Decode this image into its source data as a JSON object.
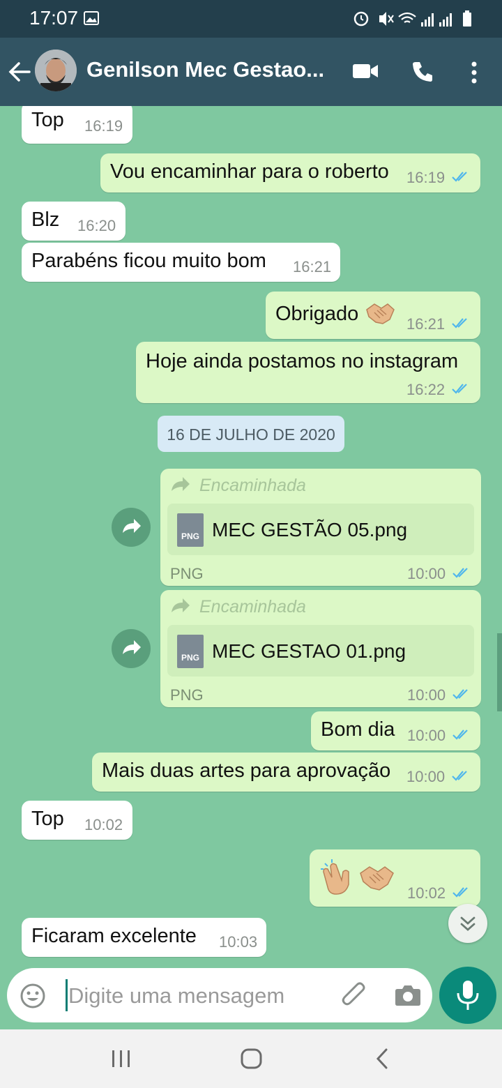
{
  "status_bar": {
    "time": "17:07"
  },
  "header": {
    "contact_name": "Genilson Mec Gestao..."
  },
  "messages": [
    {
      "text": "Top",
      "time": "16:19"
    },
    {
      "text": "Vou encaminhar para o roberto",
      "time": "16:19"
    },
    {
      "text": "Blz",
      "time": "16:20"
    },
    {
      "text": "Parabéns ficou muito bom",
      "time": "16:21"
    },
    {
      "text": "Obrigado",
      "time": "16:21"
    },
    {
      "text": "Hoje ainda postamos no instagram",
      "time": "16:22"
    },
    {
      "text": "Bom dia",
      "time": "10:00"
    },
    {
      "text": "Mais duas artes para aprovação",
      "time": "10:00"
    },
    {
      "text": "Top",
      "time": "10:02"
    },
    {
      "text": "",
      "time": "10:02"
    },
    {
      "text": "Ficaram excelente",
      "time": "10:03"
    }
  ],
  "date_separator": "16 DE JULHO DE 2020",
  "files": [
    {
      "forward_label": "Encaminhada",
      "icon_label": "PNG",
      "name": "MEC GESTÃO 05.png",
      "type": "PNG",
      "time": "10:00"
    },
    {
      "forward_label": "Encaminhada",
      "icon_label": "PNG",
      "name": "MEC GESTAO 01.png",
      "type": "PNG",
      "time": "10:00"
    }
  ],
  "input": {
    "placeholder": "Digite uma mensagem",
    "value": ""
  },
  "colors": {
    "header": "#325463",
    "chat_bg": "#7fc8a0",
    "outgoing": "#dcf8c6",
    "incoming": "#ffffff",
    "read_ticks": "#4fb6ec",
    "mic": "#0a8a7a"
  },
  "icons": [
    "back-arrow-icon",
    "video-call-icon",
    "phone-icon",
    "more-options-icon",
    "handshake-emoji-icon",
    "clapping-emoji-icon",
    "forward-icon",
    "emoji-icon",
    "attach-icon",
    "camera-icon",
    "mic-icon",
    "chevron-double-down-icon"
  ]
}
